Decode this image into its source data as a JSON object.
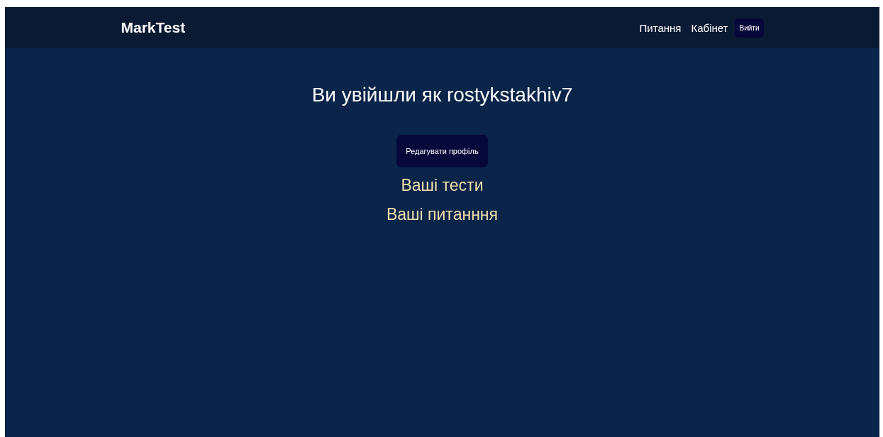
{
  "navbar": {
    "brand": "MarkTest",
    "links": [
      {
        "label": "Питання"
      },
      {
        "label": "Кабінет"
      }
    ],
    "logout_button": "Вийти"
  },
  "main": {
    "heading": "Ви увійшли як rostykstakhiv7",
    "edit_profile_button": "Редагувати профіль",
    "links": [
      {
        "label": "Ваші тести"
      },
      {
        "label": "Ваші питанння"
      }
    ]
  }
}
